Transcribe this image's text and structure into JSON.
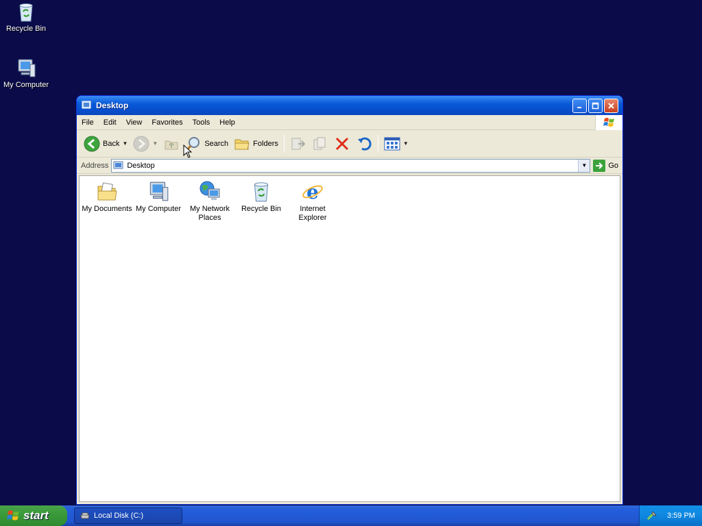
{
  "desktop": {
    "icons": [
      {
        "label": "Recycle Bin",
        "icon": "recycle-bin-icon"
      },
      {
        "label": "My Computer",
        "icon": "my-computer-icon"
      }
    ]
  },
  "window": {
    "title": "Desktop",
    "menu": [
      "File",
      "Edit",
      "View",
      "Favorites",
      "Tools",
      "Help"
    ],
    "toolbar": {
      "back": "Back",
      "search": "Search",
      "folders": "Folders"
    },
    "address": {
      "label": "Address",
      "value": "Desktop",
      "go": "Go"
    },
    "items": [
      {
        "label": "My Documents",
        "icon": "my-documents-icon"
      },
      {
        "label": "My Computer",
        "icon": "my-computer-icon"
      },
      {
        "label": "My Network Places",
        "icon": "network-places-icon"
      },
      {
        "label": "Recycle Bin",
        "icon": "recycle-bin-icon"
      },
      {
        "label": "Internet Explorer",
        "icon": "internet-explorer-icon"
      }
    ]
  },
  "taskbar": {
    "start": "start",
    "task": "Local Disk (C:)",
    "clock": "3:59 PM"
  },
  "colors": {
    "desktop_bg": "#0b0b4a",
    "titlebar": "#0a5ad8",
    "taskbar": "#245edc",
    "start_green": "#3a9b3a"
  }
}
